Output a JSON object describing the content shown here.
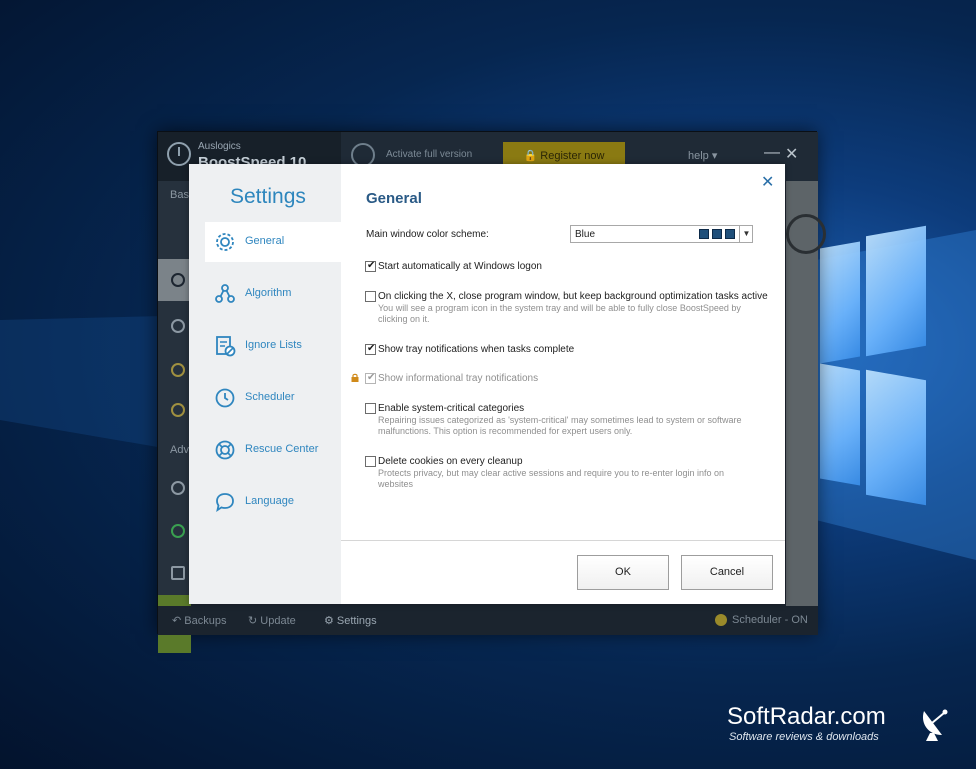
{
  "app": {
    "brand_small": "Auslogics",
    "brand_big": "BoostSpeed 10",
    "activate_text": "Activate full version",
    "register_label": "Register now",
    "help_label": "help ▾",
    "minimize": "—",
    "close": "✕",
    "sidebar_basic": "Bas",
    "sidebar_advanced": "Adv"
  },
  "bottom_bar": {
    "backups": "Backups",
    "update": "Update",
    "settings": "Settings",
    "scheduler": "Scheduler -",
    "scheduler_state": "ON"
  },
  "dialog": {
    "nav_title": "Settings",
    "nav_items": [
      {
        "label": "General",
        "icon": "gear-icon"
      },
      {
        "label": "Algorithm",
        "icon": "nodes-icon"
      },
      {
        "label": "Ignore Lists",
        "icon": "list-block-icon"
      },
      {
        "label": "Scheduler",
        "icon": "clock-icon"
      },
      {
        "label": "Rescue Center",
        "icon": "lifebuoy-icon"
      },
      {
        "label": "Language",
        "icon": "speech-bubble-icon"
      }
    ],
    "title": "General",
    "close": "✕",
    "color_scheme_label": "Main window color scheme:",
    "color_scheme_value": "Blue",
    "color_scheme_swatches": [
      "#1f4f7a",
      "#1f4f7a",
      "#1f4f7a"
    ],
    "options": {
      "start_auto": {
        "label": "Start automatically at Windows logon",
        "checked": true
      },
      "close_x": {
        "label": "On clicking the X, close program window, but keep background optimization tasks active",
        "desc": "You will see a program icon in the system tray and will be able to fully close BoostSpeed by clicking on it.",
        "checked": false
      },
      "tray_notify": {
        "label": "Show tray notifications when tasks complete",
        "checked": true
      },
      "info_notify": {
        "label": "Show informational tray notifications",
        "checked": true,
        "disabled": true
      },
      "critical": {
        "label": "Enable system-critical categories",
        "desc": "Repairing issues categorized as 'system-critical' may sometimes lead to system or software malfunctions. This option is recommended for expert users only.",
        "checked": false
      },
      "cookies": {
        "label": "Delete cookies on every cleanup",
        "desc": "Protects privacy, but may clear active sessions and require you to re-enter login info on websites",
        "checked": false
      }
    },
    "ok_label": "OK",
    "cancel_label": "Cancel"
  },
  "watermark": {
    "title": "SoftRadar.com",
    "subtitle": "Software reviews & downloads"
  },
  "colors": {
    "accent": "#2d86bd",
    "desktop": "#0d3c7c",
    "register": "#8a7a12"
  }
}
